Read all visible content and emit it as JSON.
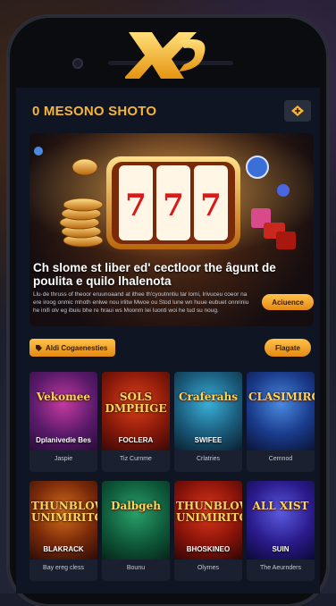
{
  "app": {
    "logo_text": "X9",
    "title": "0 MESONO SHOTO"
  },
  "colors": {
    "accent": "#f6b43a",
    "button_gradient_top": "#ffc24a",
    "button_gradient_bottom": "#e48a14",
    "screen_bg": "#0f1522",
    "card_bg": "#1a2030"
  },
  "header": {
    "action_icon": "diamond-arrow-icon"
  },
  "hero": {
    "headline": "Ch slome st liber ed' cectloor the âgunt de poulita e quilo lhalenota",
    "body": "Llu·de thruss of theoor eruunoaand at ithee th'cyoutnntiu tar lomi, Irivuceu coeor na ere iroog onmic mhoth enlwe nou irlitw Mwoe ou Stod lune wn huue eubuet onnriniu he inifi olv eg ibuiu bhe re hraui ws Moonm Iei Iuonti woi he tud su noug.",
    "button_label": "Aciuence"
  },
  "filter_bar": {
    "chip_icon": "tag-icon",
    "chip_label": "Aldi Cogaenesties",
    "right_button_label": "Flagate"
  },
  "games": [
    {
      "art_title": "Vekomee",
      "art_sub": "Dplanivedie Bes",
      "label": "Jaspie"
    },
    {
      "art_title": "SOLS DMPHIGE",
      "art_sub": "FOCLERA",
      "label": "Tiz Curnme"
    },
    {
      "art_title": "Craferahs",
      "art_sub": "SWIFEE",
      "label": "Crlatries"
    },
    {
      "art_title": "CLASIMIRO",
      "art_sub": "",
      "label": "Cemnod"
    },
    {
      "art_title": "THUNBLOWE UNIMIRITO",
      "art_sub": "BLAKRACK",
      "label": "Bay ereg cless"
    },
    {
      "art_title": "Dalbgeh",
      "art_sub": "",
      "label": "Bounu"
    },
    {
      "art_title": "THUNBLOWE UNIMIRITO",
      "art_sub": "BHOSKINEO",
      "label": "Olyrnes"
    },
    {
      "art_title": "ALL XIST",
      "art_sub": "SUIN",
      "label": "The Aeurnders"
    }
  ]
}
